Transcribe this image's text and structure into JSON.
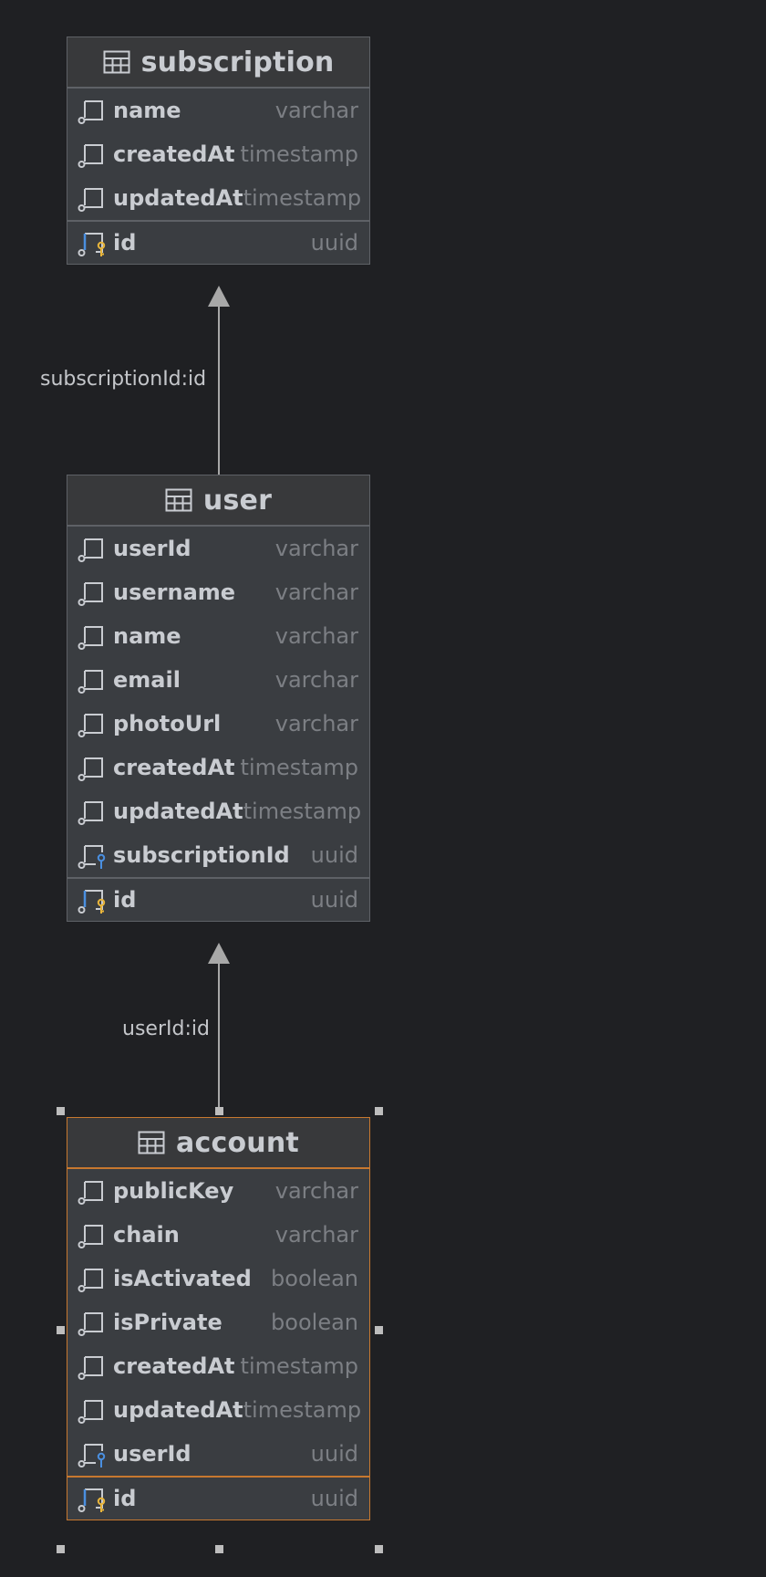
{
  "diagram": {
    "tables": [
      {
        "name": "subscription",
        "columns": [
          {
            "name": "name",
            "type": "varchar",
            "kind": "column"
          },
          {
            "name": "createdAt",
            "type": "timestamp",
            "kind": "column"
          },
          {
            "name": "updatedAt",
            "type": "timestamp",
            "kind": "column"
          }
        ],
        "primary_key": {
          "name": "id",
          "type": "uuid"
        }
      },
      {
        "name": "user",
        "columns": [
          {
            "name": "userId",
            "type": "varchar",
            "kind": "column"
          },
          {
            "name": "username",
            "type": "varchar",
            "kind": "column"
          },
          {
            "name": "name",
            "type": "varchar",
            "kind": "column"
          },
          {
            "name": "email",
            "type": "varchar",
            "kind": "column"
          },
          {
            "name": "photoUrl",
            "type": "varchar",
            "kind": "column"
          },
          {
            "name": "createdAt",
            "type": "timestamp",
            "kind": "column"
          },
          {
            "name": "updatedAt",
            "type": "timestamp",
            "kind": "column"
          },
          {
            "name": "subscriptionId",
            "type": "uuid",
            "kind": "foreign-key"
          }
        ],
        "primary_key": {
          "name": "id",
          "type": "uuid"
        }
      },
      {
        "name": "account",
        "selected": true,
        "columns": [
          {
            "name": "publicKey",
            "type": "varchar",
            "kind": "column"
          },
          {
            "name": "chain",
            "type": "varchar",
            "kind": "column"
          },
          {
            "name": "isActivated",
            "type": "boolean",
            "kind": "column"
          },
          {
            "name": "isPrivate",
            "type": "boolean",
            "kind": "column"
          },
          {
            "name": "createdAt",
            "type": "timestamp",
            "kind": "column"
          },
          {
            "name": "updatedAt",
            "type": "timestamp",
            "kind": "column"
          },
          {
            "name": "userId",
            "type": "uuid",
            "kind": "foreign-key"
          }
        ],
        "primary_key": {
          "name": "id",
          "type": "uuid"
        }
      }
    ],
    "relations": [
      {
        "from": "user",
        "to": "subscription",
        "label": "subscriptionId:id"
      },
      {
        "from": "account",
        "to": "user",
        "label": "userId:id"
      }
    ]
  },
  "icons": {
    "table": "table-grid-icon",
    "column": "column-icon",
    "foreign_key": "foreign-key-column-icon",
    "primary_key": "primary-key-column-icon"
  },
  "colors": {
    "background": "#1f2023",
    "table_body": "#3a3d41",
    "table_border": "#5e6166",
    "selection_border": "#c7782f",
    "column_text": "#c9ccd1",
    "type_text": "#7c7f84",
    "key_yellow": "#e8b53b",
    "key_blue": "#4a8fe0",
    "link": "#a8a8a8"
  }
}
